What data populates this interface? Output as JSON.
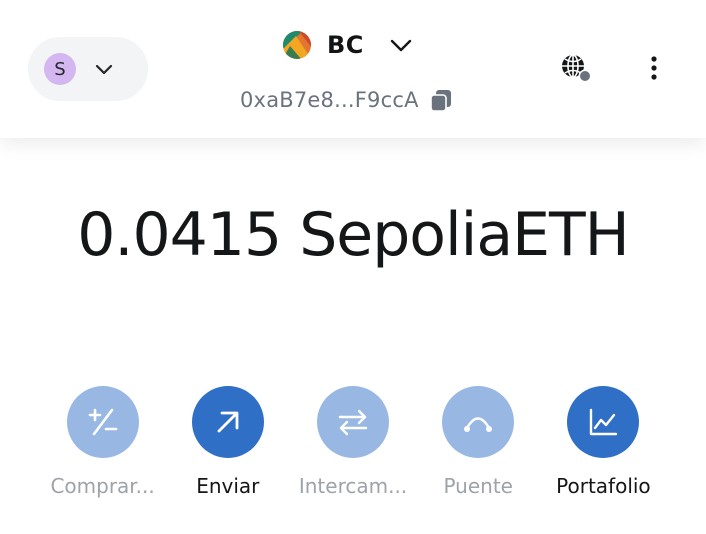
{
  "header": {
    "network_avatar_letter": "S",
    "account_name": "BC",
    "account_address": "0xaB7e8...F9ccA"
  },
  "balance": {
    "text": "0.0415 SepoliaETH"
  },
  "actions": [
    {
      "label": "Comprar...",
      "icon": "plus-minus-icon",
      "enabled": false
    },
    {
      "label": "Enviar",
      "icon": "arrow-up-right-icon",
      "enabled": true
    },
    {
      "label": "Intercam...",
      "icon": "swap-arrows-icon",
      "enabled": false
    },
    {
      "label": "Puente",
      "icon": "bridge-icon",
      "enabled": false
    },
    {
      "label": "Portafolio",
      "icon": "chart-line-icon",
      "enabled": true
    }
  ],
  "colors": {
    "accent": "#2f6fc6",
    "accent_disabled": "#98b8e3",
    "avatar": "#d4b7f0"
  }
}
